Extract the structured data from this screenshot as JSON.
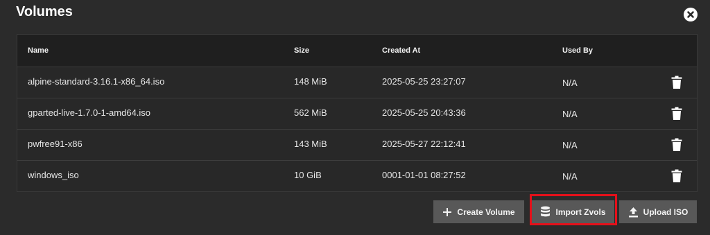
{
  "dialog": {
    "title": "Volumes",
    "close_icon": "close-icon"
  },
  "table": {
    "headers": {
      "name": "Name",
      "size": "Size",
      "created_at": "Created At",
      "used_by": "Used By"
    },
    "rows": [
      {
        "name": "alpine-standard-3.16.1-x86_64.iso",
        "size": "148 MiB",
        "created_at": "2025-05-25 23:27:07",
        "used_by": "N/A"
      },
      {
        "name": "gparted-live-1.7.0-1-amd64.iso",
        "size": "562 MiB",
        "created_at": "2025-05-25 20:43:36",
        "used_by": "N/A"
      },
      {
        "name": "pwfree91-x86",
        "size": "143 MiB",
        "created_at": "2025-05-27 22:12:41",
        "used_by": "N/A"
      },
      {
        "name": "windows_iso",
        "size": "10 GiB",
        "created_at": "0001-01-01 08:27:52",
        "used_by": "N/A"
      }
    ],
    "row_action_icon": "trash-icon"
  },
  "actions": {
    "create_volume": {
      "label": "Create Volume",
      "icon": "plus-icon"
    },
    "import_zvols": {
      "label": "Import Zvols",
      "icon": "database-icon"
    },
    "upload_iso": {
      "label": "Upload ISO",
      "icon": "upload-icon"
    }
  },
  "colors": {
    "background": "#2b2b2b",
    "table_header": "#1f1f1f",
    "button": "#585858",
    "highlight": "#e5101a"
  }
}
